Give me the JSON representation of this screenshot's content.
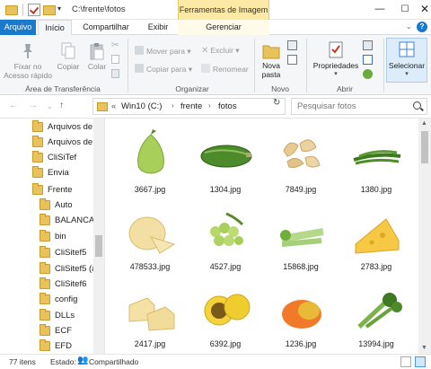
{
  "window": {
    "path_title": "C:\\frente\\fotos",
    "context_tab": "Ferramentas de Imagem",
    "controls": {
      "minimize": "—",
      "maximize": "☐",
      "close": "✕"
    }
  },
  "tabs": {
    "arquivo": "Arquivo",
    "inicio": "Início",
    "compartilhar": "Compartilhar",
    "exibir": "Exibir",
    "gerenciar": "Gerenciar"
  },
  "ribbon": {
    "fixar": "Fixar no Acesso rápido",
    "copiar": "Copiar",
    "colar": "Colar",
    "area_transferencia": "Área de Transferência",
    "mover_para": "Mover para ▾",
    "copiar_para": "Copiar para ▾",
    "excluir": "Excluir ▾",
    "renomear": "Renomear",
    "organizar": "Organizar",
    "nova_pasta": "Nova pasta",
    "novo": "Novo",
    "propriedades": "Propriedades",
    "abrir": "Abrir",
    "selecionar": "Selecionar"
  },
  "address": {
    "prefix": "«",
    "parts": [
      "Win10 (C:)",
      "frente",
      "fotos"
    ],
    "search_placeholder": "Pesquisar fotos"
  },
  "nav": {
    "items": [
      {
        "label": "Arquivos de P",
        "indent": 0
      },
      {
        "label": "Arquivos de P",
        "indent": 0
      },
      {
        "label": "CliSiTef",
        "indent": 0
      },
      {
        "label": "Envia",
        "indent": 0
      },
      {
        "label": "Frente",
        "indent": 0
      },
      {
        "label": "Auto",
        "indent": 1
      },
      {
        "label": "BALANCA",
        "indent": 1
      },
      {
        "label": "bin",
        "indent": 1
      },
      {
        "label": "CliSitef5",
        "indent": 1
      },
      {
        "label": "CliSitef5 (ab",
        "indent": 1
      },
      {
        "label": "CliSitef6",
        "indent": 1
      },
      {
        "label": "config",
        "indent": 1
      },
      {
        "label": "DLLs",
        "indent": 1
      },
      {
        "label": "ECF",
        "indent": 1
      },
      {
        "label": "EFD",
        "indent": 1
      }
    ]
  },
  "files": [
    {
      "name": "3667.jpg",
      "icon": "guava-icon"
    },
    {
      "name": "1304.jpg",
      "icon": "zucchini-icon"
    },
    {
      "name": "7849.jpg",
      "icon": "cashew-icon"
    },
    {
      "name": "1380.jpg",
      "icon": "green-beans-icon"
    },
    {
      "name": "478533.jpg",
      "icon": "cheese-wheel-icon"
    },
    {
      "name": "4527.jpg",
      "icon": "grapes-icon"
    },
    {
      "name": "15868.jpg",
      "icon": "celery-icon"
    },
    {
      "name": "2783.jpg",
      "icon": "swiss-cheese-icon"
    },
    {
      "name": "2417.jpg",
      "icon": "cheese-blocks-icon"
    },
    {
      "name": "6392.jpg",
      "icon": "passion-fruit-icon"
    },
    {
      "name": "1236.jpg",
      "icon": "mango-icon"
    },
    {
      "name": "13994.jpg",
      "icon": "broccoli-icon"
    }
  ],
  "status": {
    "count": "77 itens",
    "state_label": "Estado:",
    "state_value": "Compartilhado"
  }
}
